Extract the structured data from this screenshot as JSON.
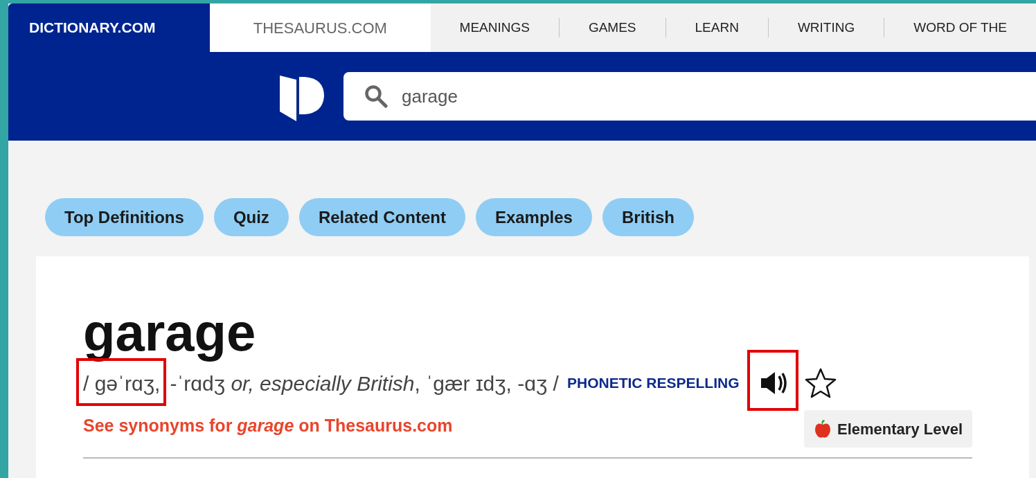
{
  "site_tabs": [
    {
      "label": "DICTIONARY.COM",
      "selected": true
    },
    {
      "label": "THESAURUS.COM",
      "selected": false
    }
  ],
  "nav": [
    "MEANINGS",
    "GAMES",
    "LEARN",
    "WRITING",
    "WORD OF THE"
  ],
  "search": {
    "value": "garage"
  },
  "section_pills": [
    "Top Definitions",
    "Quiz",
    "Related Content",
    "Examples",
    "British"
  ],
  "entry": {
    "word": "garage",
    "pronunciation_highlighted": "/ gəˈrɑʒ,",
    "pronunciation_rest": "-ˈrɑdʒ *or, especially British*, ˈgær ɪdʒ, -ɑʒ /",
    "respelling_toggle": "PHONETIC RESPELLING",
    "audio_highlighted": true,
    "favorite": false,
    "synonyms_link": "See synonyms for *garage* on Thesaurus.com",
    "level": "Elementary Level"
  }
}
